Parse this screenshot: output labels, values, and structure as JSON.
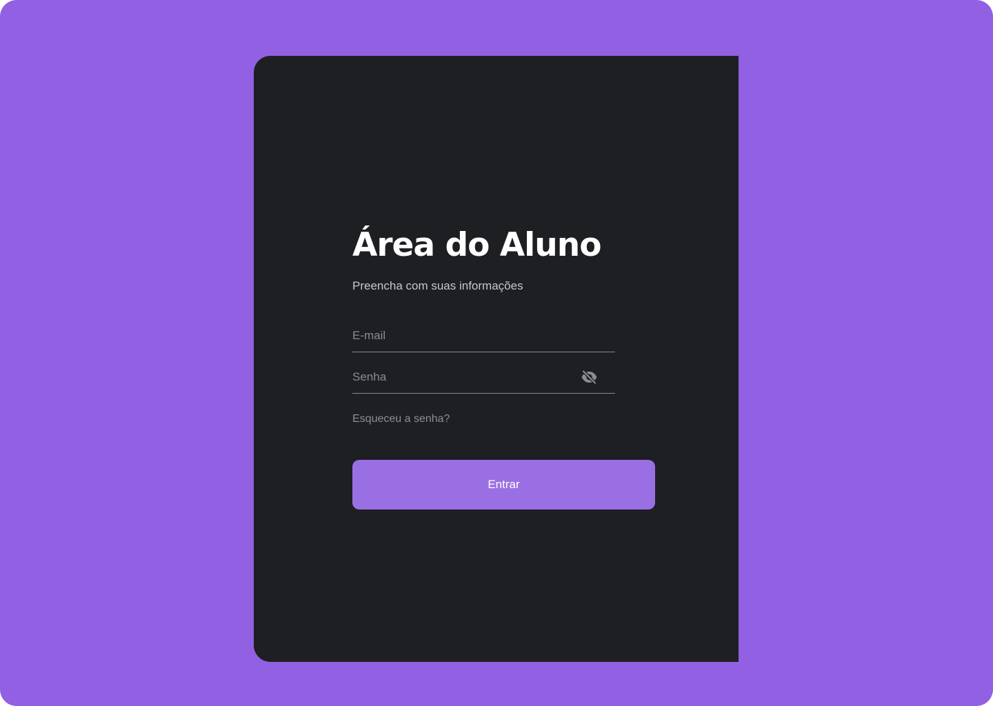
{
  "colors": {
    "background": "#9260e2",
    "card": "#1e1f22",
    "accent": "#9b6fe4",
    "input_line": "#8a8a8e"
  },
  "login": {
    "title": "Área do Aluno",
    "subtitle": "Preencha com suas informações",
    "email_placeholder": "E-mail",
    "password_placeholder": "Senha",
    "password_toggle_icon": "eye-off-icon",
    "forgot_password": "Esqueceu a senha?",
    "submit_label": "Entrar"
  }
}
